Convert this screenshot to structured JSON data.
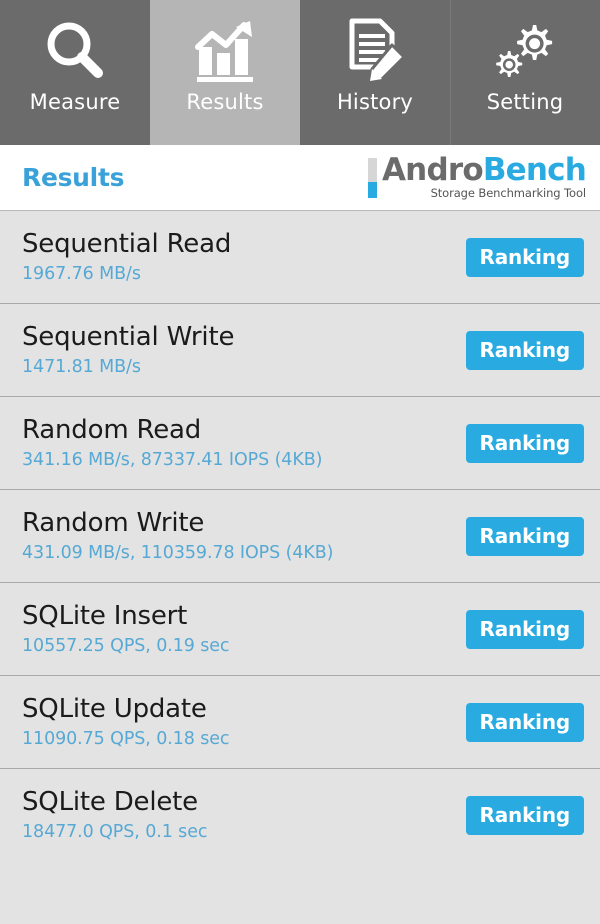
{
  "tabs": [
    {
      "label": "Measure",
      "icon": "magnifier-icon",
      "active": false
    },
    {
      "label": "Results",
      "icon": "bar-chart-icon",
      "active": true
    },
    {
      "label": "History",
      "icon": "document-pencil-icon",
      "active": false
    },
    {
      "label": "Setting",
      "icon": "gears-icon",
      "active": false
    }
  ],
  "header": {
    "page_title": "Results",
    "logo": {
      "primary": "Andro",
      "secondary": "Bench",
      "tagline": "Storage Benchmarking Tool"
    }
  },
  "results": [
    {
      "name": "Sequential Read",
      "value": "1967.76 MB/s",
      "button": "Ranking"
    },
    {
      "name": "Sequential Write",
      "value": "1471.81 MB/s",
      "button": "Ranking"
    },
    {
      "name": "Random Read",
      "value": "341.16 MB/s, 87337.41 IOPS (4KB)",
      "button": "Ranking"
    },
    {
      "name": "Random Write",
      "value": "431.09 MB/s, 110359.78 IOPS (4KB)",
      "button": "Ranking"
    },
    {
      "name": "SQLite Insert",
      "value": "10557.25 QPS, 0.19 sec",
      "button": "Ranking"
    },
    {
      "name": "SQLite Update",
      "value": "11090.75 QPS, 0.18 sec",
      "button": "Ranking"
    },
    {
      "name": "SQLite Delete",
      "value": "18477.0 QPS, 0.1 sec",
      "button": "Ranking"
    }
  ],
  "colors": {
    "accent_blue": "#29abe2",
    "value_blue": "#56a9d4",
    "tabbar_gray": "#6b6b6b",
    "tab_active_gray": "#b5b5b5",
    "list_gray": "#e3e3e3"
  }
}
